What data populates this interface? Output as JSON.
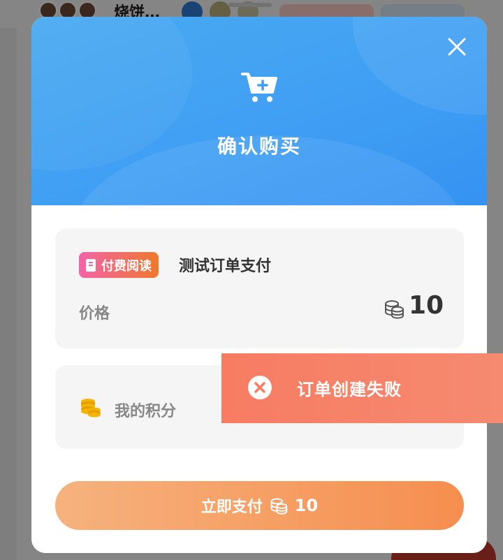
{
  "background": {
    "title": "烧饼…"
  },
  "modal": {
    "title": "确认购买",
    "close_icon": "close-icon",
    "header_icon": "cart-plus-icon"
  },
  "product": {
    "tag_label": "付费阅读",
    "tag_icon": "book-icon",
    "name": "测试订单支付",
    "price_label": "价格",
    "price_value": "10",
    "price_icon": "coins-stack-icon"
  },
  "points": {
    "label": "我的积分",
    "icon": "gold-coins-icon"
  },
  "pay_button": {
    "label": "立即支付",
    "value": "10",
    "icon": "coins-stack-icon"
  },
  "toast": {
    "text": "订单创建失败",
    "icon": "error-x-icon"
  },
  "colors": {
    "header_blue": "#3f9ef3",
    "pay_orange": "#f68e4f",
    "toast_red": "#f77c62",
    "tag_pink": "#f463a8"
  }
}
